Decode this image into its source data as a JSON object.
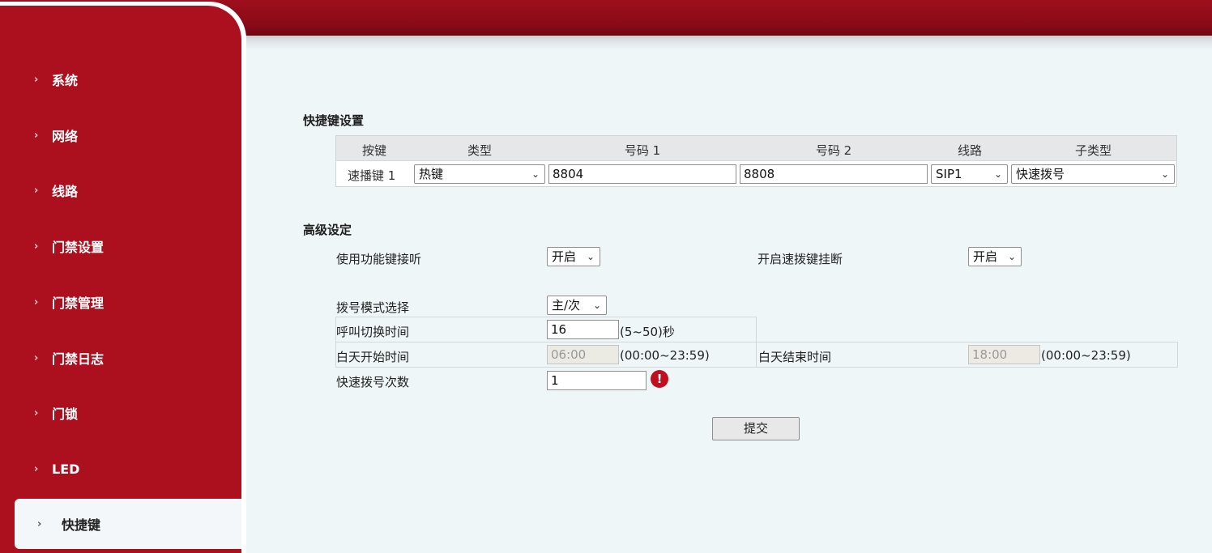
{
  "sidebar": {
    "items": [
      {
        "label": "系统"
      },
      {
        "label": "网络"
      },
      {
        "label": "线路"
      },
      {
        "label": "门禁设置"
      },
      {
        "label": "门禁管理"
      },
      {
        "label": "门禁日志"
      },
      {
        "label": "门锁"
      },
      {
        "label": "LED"
      },
      {
        "label": "快捷键"
      }
    ],
    "active": "快捷键"
  },
  "shortcut": {
    "title": "快捷键设置",
    "headers": [
      "按键",
      "类型",
      "号码 1",
      "号码 2",
      "线路",
      "子类型"
    ],
    "row": {
      "key": "速播键 1",
      "type": "热键",
      "number1": "8804",
      "number2": "8808",
      "line": "SIP1",
      "subtype": "快速拨号"
    }
  },
  "advanced": {
    "title": "高级设定",
    "use_func_key_answer_label": "使用功能键接听",
    "use_func_key_answer_value": "开启",
    "speed_dial_hangup_label": "开启速拨键挂断",
    "speed_dial_hangup_value": "开启",
    "dial_mode_label": "拨号模式选择",
    "dial_mode_value": "主/次",
    "call_switch_time_label": "呼叫切换时间",
    "call_switch_time_value": "16",
    "call_switch_time_hint": "(5~50)秒",
    "day_start_label": "白天开始时间",
    "day_start_value": "06:00",
    "day_start_hint": "(00:00~23:59)",
    "day_end_label": "白天结束时间",
    "day_end_value": "18:00",
    "day_end_hint": "(00:00~23:59)",
    "speed_dial_count_label": "快速拨号次数",
    "speed_dial_count_value": "1"
  },
  "submit_label": "提交",
  "colors": {
    "brand_red": "#ac101f",
    "topbar_red": "#8a0a17",
    "content_bg": "#eef6f8"
  }
}
